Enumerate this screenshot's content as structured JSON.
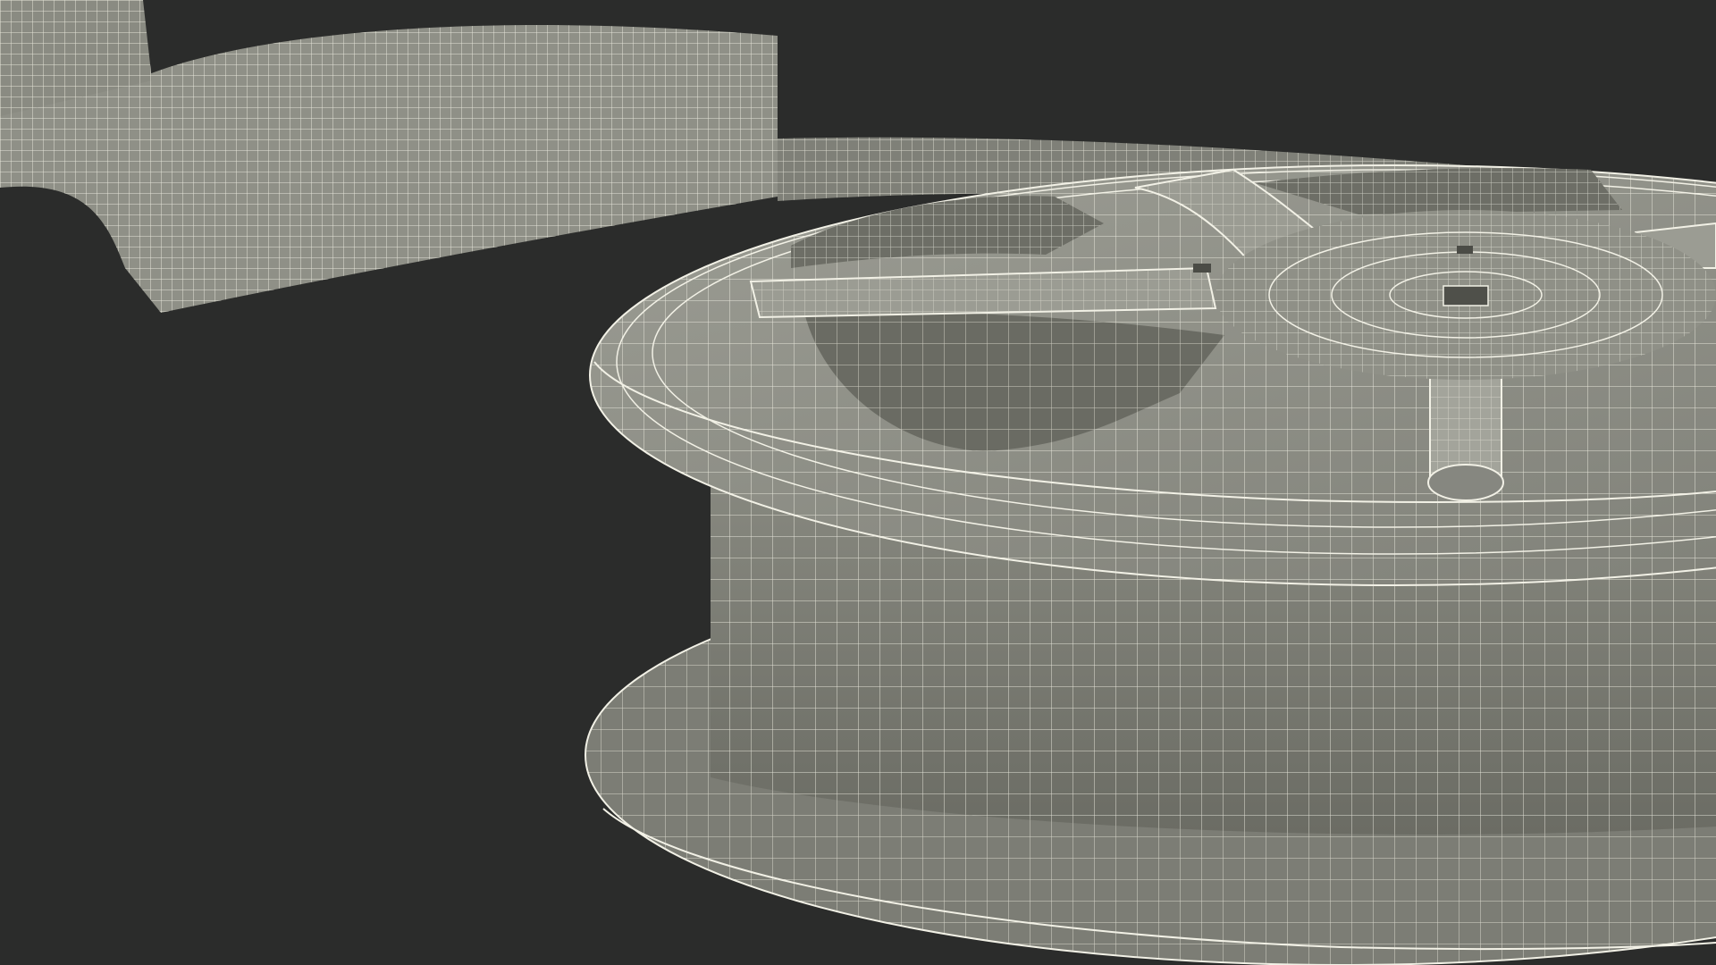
{
  "scene": {
    "background_color": "#2b2c2b",
    "surface_color": "#8e8e84",
    "surface_shadow_color": "#5f6058",
    "wire_color": "#f2f1e6",
    "objects": [
      "film-strip",
      "film-reel"
    ]
  }
}
